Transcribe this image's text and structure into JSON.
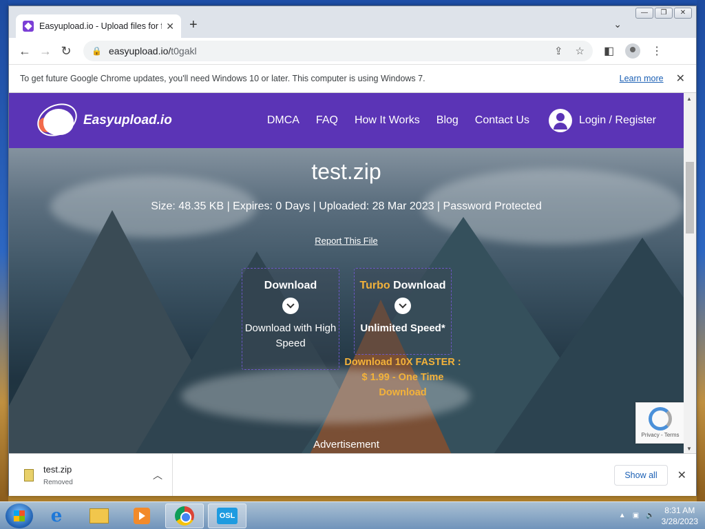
{
  "browser": {
    "tab_title": "Easyupload.io - Upload files for fr",
    "url_host": "easyupload.io/",
    "url_path": "t0gakl",
    "infobar_text": "To get future Google Chrome updates, you'll need Windows 10 or later. This computer is using Windows 7.",
    "infobar_link": "Learn more"
  },
  "site": {
    "logo_text": "Easyupload.io",
    "nav": [
      "DMCA",
      "FAQ",
      "How It Works",
      "Blog",
      "Contact Us"
    ],
    "login_label": "Login / Register"
  },
  "file": {
    "name": "test.zip",
    "meta": "Size: 48.35 KB | Expires: 0 Days | Uploaded: 28 Mar 2023 | Password Protected",
    "report": "Report This File"
  },
  "download": {
    "title": "Download",
    "subtitle": "Download with High Speed"
  },
  "turbo": {
    "title_accent": "Turbo",
    "title_rest": " Download",
    "subtitle": "Unlimited Speed*",
    "promo": "Download 10X FASTER : $ 1.99 - One Time Download"
  },
  "advertisement": "Advertisement",
  "recaptcha": {
    "text": "Privacy - Terms"
  },
  "shelf": {
    "file_name": "test.zip",
    "status": "Removed",
    "show_all": "Show all"
  },
  "taskbar": {
    "time": "8:31 AM",
    "date": "3/28/2023",
    "osl_label": "OSL"
  },
  "colors": {
    "brand_purple": "#5b34b6",
    "turbo_orange": "#f3b23a"
  }
}
